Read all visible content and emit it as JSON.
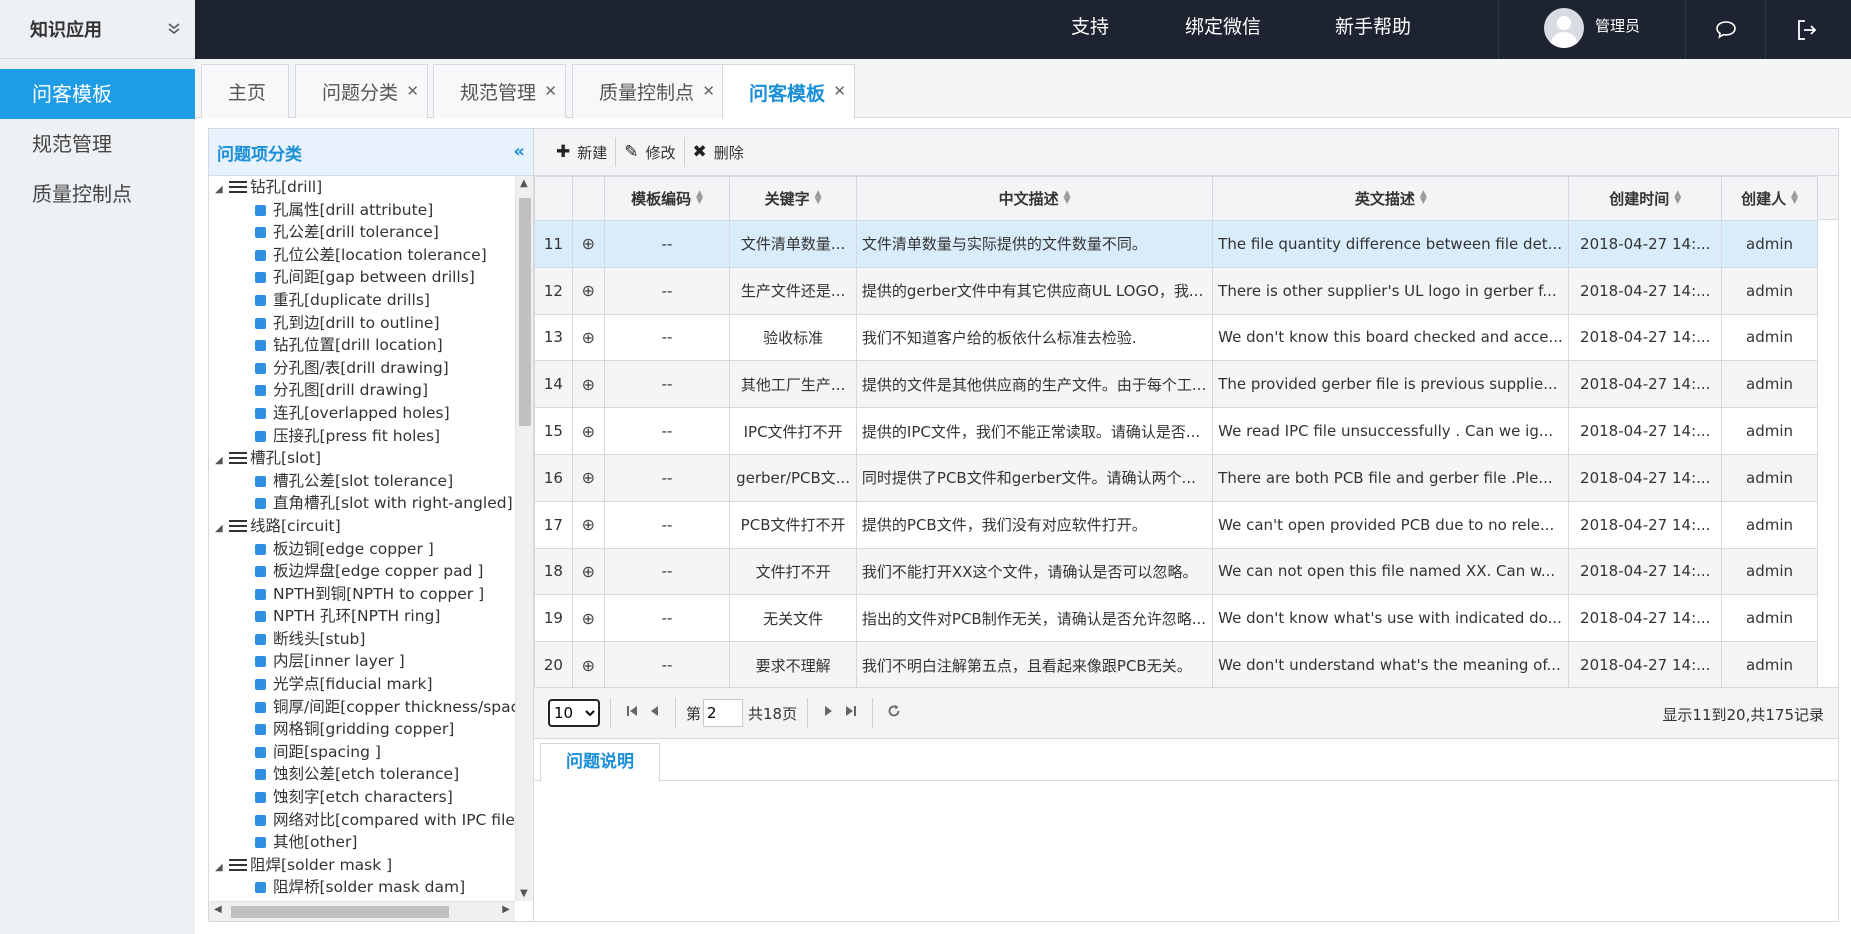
{
  "sidebar": {
    "title": "知识应用",
    "items": [
      {
        "label": "问客模板",
        "active": true
      },
      {
        "label": "规范管理",
        "active": false
      },
      {
        "label": "质量控制点",
        "active": false
      }
    ]
  },
  "topbar": {
    "links": [
      "支持",
      "绑定微信",
      "新手帮助"
    ],
    "username": "管理员"
  },
  "tabs": [
    {
      "label": "主页",
      "closable": false
    },
    {
      "label": "问题分类",
      "closable": true
    },
    {
      "label": "规范管理",
      "closable": true
    },
    {
      "label": "质量控制点",
      "closable": true
    },
    {
      "label": "问客模板",
      "closable": true,
      "active": true
    }
  ],
  "tree": {
    "title": "问题项分类",
    "nodes": [
      {
        "type": "parent",
        "label": "钻孔[drill]"
      },
      {
        "type": "leaf",
        "label": "孔属性[drill attribute]"
      },
      {
        "type": "leaf",
        "label": "孔公差[drill tolerance]"
      },
      {
        "type": "leaf",
        "label": "孔位公差[location tolerance]"
      },
      {
        "type": "leaf",
        "label": "孔间距[gap between drills]"
      },
      {
        "type": "leaf",
        "label": "重孔[duplicate drills]"
      },
      {
        "type": "leaf",
        "label": "孔到边[drill to outline]"
      },
      {
        "type": "leaf",
        "label": "钻孔位置[drill location]"
      },
      {
        "type": "leaf",
        "label": "分孔图/表[drill drawing]"
      },
      {
        "type": "leaf",
        "label": "分孔图[drill drawing]"
      },
      {
        "type": "leaf",
        "label": "连孔[overlapped holes]"
      },
      {
        "type": "leaf",
        "label": "压接孔[press fit holes]"
      },
      {
        "type": "parent",
        "label": "槽孔[slot]"
      },
      {
        "type": "leaf",
        "label": "槽孔公差[slot tolerance]"
      },
      {
        "type": "leaf",
        "label": "直角槽孔[slot with right-angled]"
      },
      {
        "type": "parent",
        "label": "线路[circuit]"
      },
      {
        "type": "leaf",
        "label": "板边铜[edge copper ]"
      },
      {
        "type": "leaf",
        "label": "板边焊盘[edge copper pad ]"
      },
      {
        "type": "leaf",
        "label": "NPTH到铜[NPTH to copper ]"
      },
      {
        "type": "leaf",
        "label": "NPTH 孔环[NPTH ring]"
      },
      {
        "type": "leaf",
        "label": "断线头[stub]"
      },
      {
        "type": "leaf",
        "label": "内层[inner layer ]"
      },
      {
        "type": "leaf",
        "label": "光学点[fiducial mark]"
      },
      {
        "type": "leaf",
        "label": "铜厚/间距[copper thickness/spac"
      },
      {
        "type": "leaf",
        "label": "网格铜[gridding copper]"
      },
      {
        "type": "leaf",
        "label": "间距[spacing ]"
      },
      {
        "type": "leaf",
        "label": "蚀刻公差[etch tolerance]"
      },
      {
        "type": "leaf",
        "label": "蚀刻字[etch characters]"
      },
      {
        "type": "leaf",
        "label": "网络对比[compared with IPC file]"
      },
      {
        "type": "leaf",
        "label": "其他[other]"
      },
      {
        "type": "parent",
        "label": "阻焊[solder mask ]"
      },
      {
        "type": "leaf",
        "label": "阻焊桥[solder mask dam]"
      }
    ]
  },
  "toolbar": {
    "new_label": "新建",
    "edit_label": "修改",
    "delete_label": "删除"
  },
  "table": {
    "columns": [
      "模板编码",
      "关键字",
      "中文描述",
      "英文描述",
      "创建时间",
      "创建人"
    ],
    "rows": [
      {
        "no": "11",
        "code": "--",
        "keyword": "文件清单数量...",
        "cn": "文件清单数量与实际提供的文件数量不同。",
        "en": "The file quantity difference between file det...",
        "time": "2018-04-27 14:...",
        "creator": "admin"
      },
      {
        "no": "12",
        "code": "--",
        "keyword": "生产文件还是...",
        "cn": "提供的gerber文件中有其它供应商UL LOGO，我...",
        "en": "There is other supplier's UL logo in gerber f...",
        "time": "2018-04-27 14:...",
        "creator": "admin"
      },
      {
        "no": "13",
        "code": "--",
        "keyword": "验收标准",
        "cn": "我们不知道客户给的板依什么标准去检验.",
        "en": "We don't know this board checked and acce...",
        "time": "2018-04-27 14:...",
        "creator": "admin"
      },
      {
        "no": "14",
        "code": "--",
        "keyword": "其他工厂生产...",
        "cn": "提供的文件是其他供应商的生产文件。由于每个工...",
        "en": "The provided gerber file is previous supplie...",
        "time": "2018-04-27 14:...",
        "creator": "admin"
      },
      {
        "no": "15",
        "code": "--",
        "keyword": "IPC文件打不开",
        "cn": "提供的IPC文件，我们不能正常读取。请确认是否...",
        "en": "We read IPC file unsuccessfully . Can we ig...",
        "time": "2018-04-27 14:...",
        "creator": "admin"
      },
      {
        "no": "16",
        "code": "--",
        "keyword": "gerber/PCB文...",
        "cn": "同时提供了PCB文件和gerber文件。请确认两个...",
        "en": "There are both PCB file and gerber file .Ple...",
        "time": "2018-04-27 14:...",
        "creator": "admin"
      },
      {
        "no": "17",
        "code": "--",
        "keyword": "PCB文件打不开",
        "cn": "提供的PCB文件，我们没有对应软件打开。",
        "en": "We can't open provided PCB due to no rele...",
        "time": "2018-04-27 14:...",
        "creator": "admin"
      },
      {
        "no": "18",
        "code": "--",
        "keyword": "文件打不开",
        "cn": "我们不能打开XX这个文件，请确认是否可以忽略。",
        "en": "We can not open this file named XX. Can w...",
        "time": "2018-04-27 14:...",
        "creator": "admin"
      },
      {
        "no": "19",
        "code": "--",
        "keyword": "无关文件",
        "cn": "指出的文件对PCB制作无关，请确认是否允许忽略...",
        "en": "We don't know what's use with indicated do...",
        "time": "2018-04-27 14:...",
        "creator": "admin"
      },
      {
        "no": "20",
        "code": "--",
        "keyword": "要求不理解",
        "cn": "我们不明白注解第五点，且看起来像跟PCB无关。",
        "en": "We don't understand what's the meaning of...",
        "time": "2018-04-27 14:...",
        "creator": "admin"
      }
    ]
  },
  "pager": {
    "page_size": "10",
    "page_prefix": "第",
    "current_page": "2",
    "total_pages": "共18页",
    "info": "显示11到20,共175记录"
  },
  "detail": {
    "tab_label": "问题说明"
  },
  "colors": {
    "accent": "#1e9ce6",
    "topbar_bg": "#1d2331",
    "selected_row": "#d9ecfa"
  }
}
